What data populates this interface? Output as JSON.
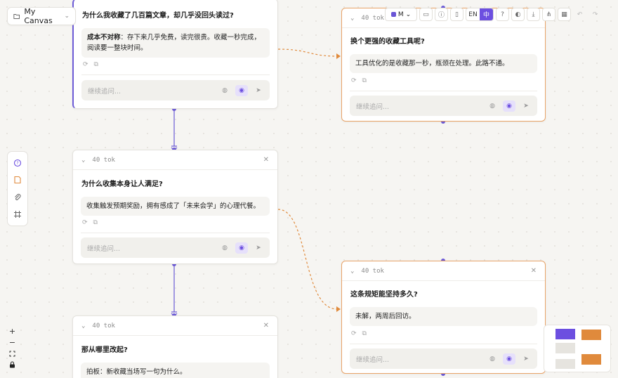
{
  "canvas": {
    "name": "My Canvas"
  },
  "toolbar": {
    "model_label": "M",
    "lang_en": "EN",
    "lang_zh": "中"
  },
  "cards": {
    "c1": {
      "question": "为什么我收藏了几百篇文章，却几乎没回头读过?",
      "answer_bold": "成本不对称",
      "answer_rest": "：存下来几乎免费，读完很贵。收藏一秒完成，阅读要一整块时间。",
      "followup_placeholder": "继续追问..."
    },
    "c2": {
      "tokens": "40 tok",
      "question": "换个更强的收藏工具呢?",
      "answer": "工具优化的是收藏那一秒，瓶颈在处理。此路不通。",
      "followup_placeholder": "继续追问..."
    },
    "c3": {
      "tokens": "40 tok",
      "question": "为什么收集本身让人满足?",
      "answer": "收集触发预期奖励，拥有感成了「未来会学」的心理代餐。",
      "followup_placeholder": "继续追问..."
    },
    "c4": {
      "tokens": "40 tok",
      "question": "这条规矩能坚持多久?",
      "answer": "未解，两周后回访。",
      "followup_placeholder": "继续追问..."
    },
    "c5": {
      "tokens": "40 tok",
      "question": "那从哪里改起?",
      "answer": "拍板：新收藏当场写一句为什么。"
    }
  },
  "icons": {
    "folder": "folder-icon",
    "chevron": "chevron-down-icon",
    "close": "close-icon",
    "globe": "globe-icon",
    "brain": "brain-icon",
    "send": "send-icon",
    "regenerate": "refresh-icon",
    "copy": "copy-icon"
  },
  "colors": {
    "accent_purple": "#6c4fe0",
    "accent_orange": "#e08a3c",
    "edge_purple": "#6c5bd6",
    "edge_orange": "#e08a3c"
  }
}
